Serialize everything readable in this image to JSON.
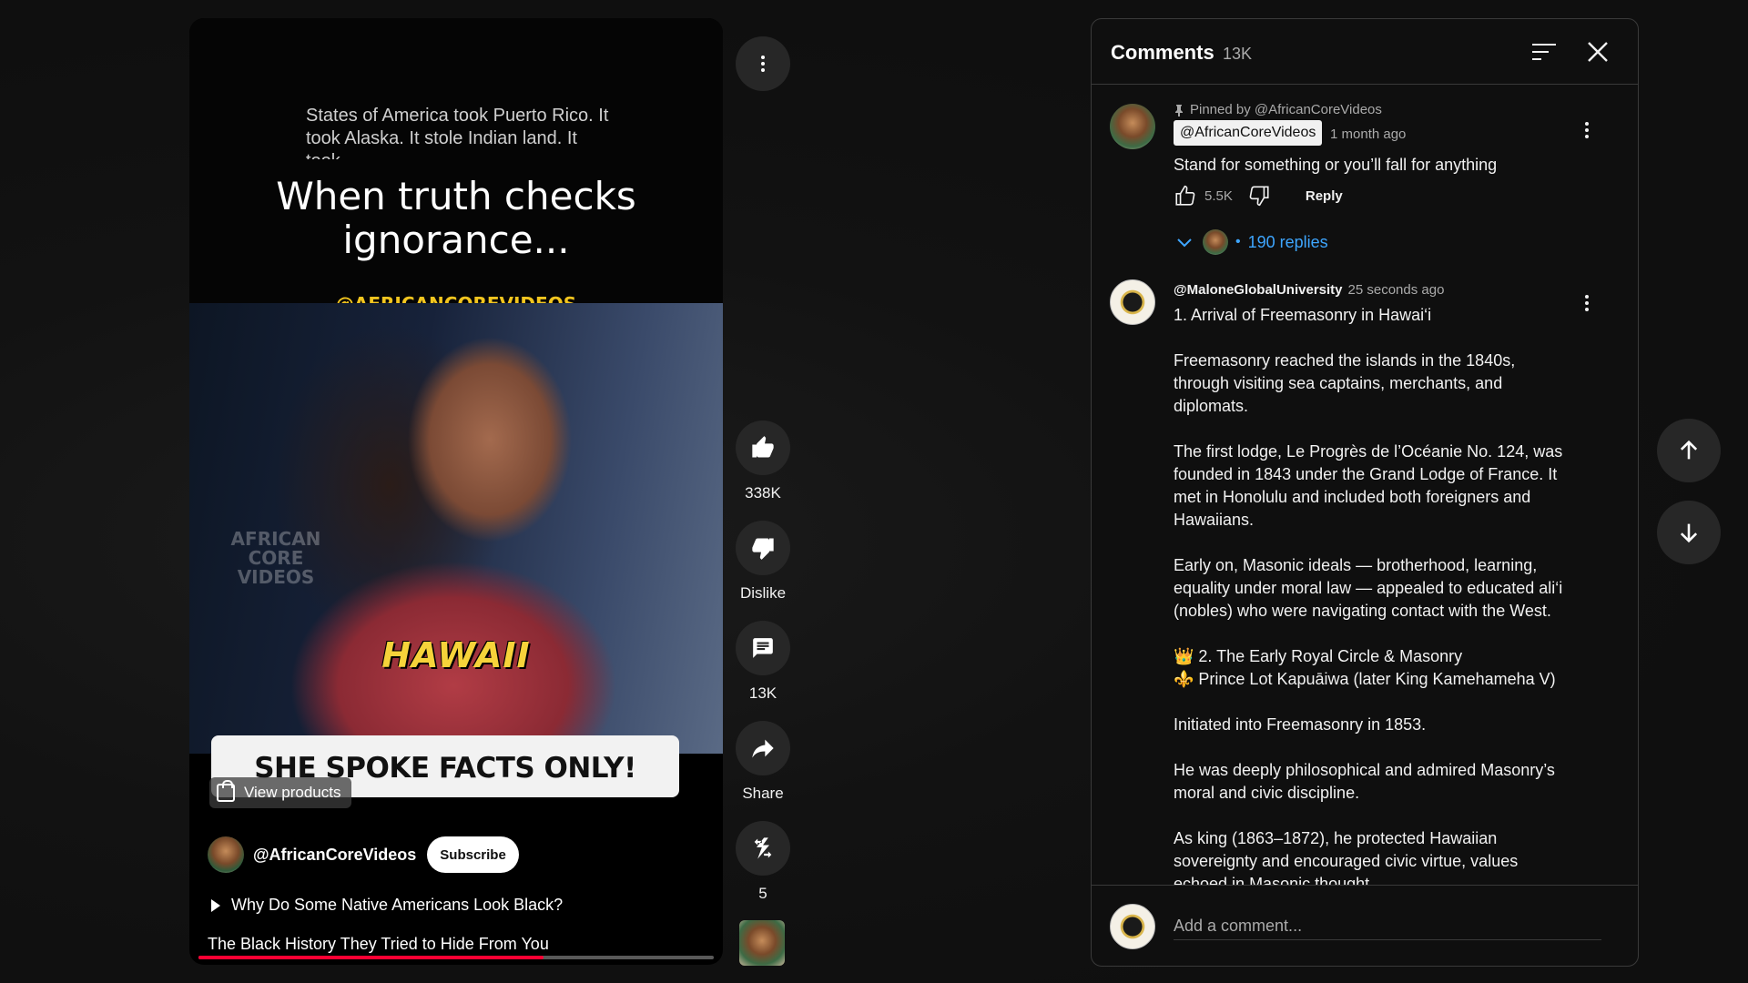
{
  "player": {
    "scroll_text": "States of America took Puerto Rico. It took Alaska. It stole Indian land. It took",
    "headline": "When truth checks ignorance...",
    "watermark_handle": "@AFRICANCOREVIDEOS",
    "scene_caption": "HAWAII",
    "scene_watermark": "AFRICAN CORE VIDEOS",
    "banner_text": "SHE SPOKE FACTS ONLY!",
    "view_products": "View products",
    "channel_name": "@AfricanCoreVideos",
    "subscribe_label": "Subscribe",
    "related_video": "Why Do Some Native Americans Look Black?",
    "video_title": "The Black History They Tried to Hide From You",
    "progress": 0.67
  },
  "actions": {
    "like_count": "338K",
    "dislike_label": "Dislike",
    "comments_count": "13K",
    "share_label": "Share",
    "remix_count": "5"
  },
  "comments": {
    "title": "Comments",
    "count": "13K",
    "pinned_label": "Pinned by @AfricanCoreVideos",
    "list": [
      {
        "author": "@AfricanCoreVideos",
        "time": "1 month ago",
        "text": "Stand for something or you’ll fall for anything",
        "likes": "5.5K",
        "reply_label": "Reply",
        "replies": "190 replies"
      },
      {
        "author": "@MaloneGlobalUniversity",
        "time": "25 seconds ago",
        "text": "1. Arrival of Freemasonry in Hawai‘i\n\nFreemasonry reached the islands in the 1840s, through visiting sea captains, merchants, and diplomats.\n\nThe first lodge, Le Progrès de l’Océanie No. 124, was founded in 1843 under the Grand Lodge of France. It met in Honolulu and included both foreigners and Hawaiians.\n\nEarly on, Masonic ideals — brotherhood, learning, equality under moral law — appealed to educated ali‘i (nobles) who were navigating contact with the West.\n\n👑 2. The Early Royal Circle & Masonry\n⚜️ Prince Lot Kapuāiwa (later King Kamehameha V)\n\nInitiated into Freemasonry in 1853.\n\nHe was deeply philosophical and admired Masonry’s moral and civic discipline.\n\nAs king (1863–1872), he protected Hawaiian sovereignty and encouraged civic virtue, values echoed in Masonic thought."
      }
    ],
    "add_placeholder": "Add a comment..."
  },
  "icons": {
    "more": "more-vert-icon",
    "like": "thumb-up-icon",
    "dislike": "thumb-down-icon",
    "comment": "comment-icon",
    "share": "share-icon",
    "remix": "remix-icon",
    "sort": "sort-icon",
    "close": "close-icon",
    "nav_up": "arrow-up-icon",
    "nav_down": "arrow-down-icon"
  },
  "colors": {
    "accent_progress": "#ff0033",
    "link_blue": "#3ea6ff",
    "watermark_yellow": "#f2c51f"
  }
}
